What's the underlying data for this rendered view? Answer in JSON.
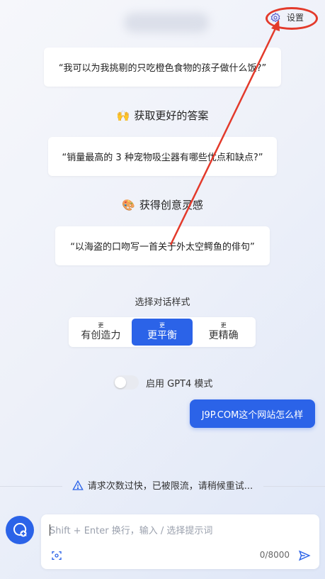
{
  "header": {
    "settings_label": "设置"
  },
  "examples": {
    "card1": "“我可以为我挑剔的只吃橙色食物的孩子做什么饭?”",
    "section2_title": "获取更好的答案",
    "section2_emoji": "🙌",
    "card2": "“销量最高的 3 种宠物吸尘器有哪些优点和缺点?”",
    "section3_title": "获得创意灵感",
    "section3_emoji": "🎨",
    "card3": "“以海盗的口吻写一首关于外太空鳄鱼的俳句”"
  },
  "style_selector": {
    "label": "选择对话样式",
    "options": [
      {
        "small": "更",
        "label": "有创造力",
        "active": false
      },
      {
        "small": "更",
        "label": "更平衡",
        "active": true
      },
      {
        "small": "更",
        "label": "更精确",
        "active": false
      }
    ]
  },
  "gpt4_toggle": {
    "label": "启用 GPT4 模式",
    "enabled": false
  },
  "user_message": "J9P.COM这个网站怎么样",
  "warning_text": "请求次数过快，已被限流，请稍候重试...",
  "input": {
    "placeholder": "Shift + Enter 换行，输入 / 选择提示词",
    "char_count": "0/8000"
  },
  "colors": {
    "accent": "#2b63e8",
    "annotation": "#e33a2b"
  },
  "icons": [
    "gear-icon",
    "warning-icon",
    "new-chat-icon",
    "scan-icon",
    "send-icon"
  ]
}
